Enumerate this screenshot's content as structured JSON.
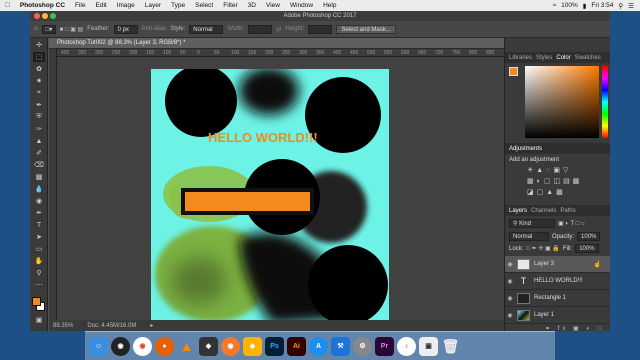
{
  "menubar": {
    "app_name": "Photoshop CC",
    "items": [
      "File",
      "Edit",
      "Image",
      "Layer",
      "Type",
      "Select",
      "Filter",
      "3D",
      "View",
      "Window",
      "Help"
    ],
    "battery": "100%",
    "clock": "Fri 3:54"
  },
  "window": {
    "title": "Adobe Photoshop CC 2017"
  },
  "options_bar": {
    "feather_label": "Feather:",
    "feather_value": "0 px",
    "antialias_label": "Anti-alias",
    "style_label": "Style:",
    "style_value": "Normal",
    "width_label": "Width:",
    "height_label": "Height:",
    "select_mask_label": "Select and Mask..."
  },
  "document": {
    "tab_title": "Photoshop Tut002 @ 88.3% (Layer 3, RGB/8*) *",
    "canvas_text": "HELLO WORLD!!!",
    "zoom": "88.35%",
    "doc_info": "Doc: 4.45M/16.0M"
  },
  "ruler_labels": [
    "400",
    "350",
    "300",
    "250",
    "200",
    "150",
    "100",
    "50",
    "0",
    "50",
    "100",
    "150",
    "200",
    "250",
    "300",
    "350",
    "400",
    "450",
    "500",
    "550",
    "600",
    "650",
    "700",
    "750",
    "800",
    "850"
  ],
  "panels": {
    "top_tabs": [
      "Libraries",
      "Styles",
      "Color",
      "Swatches"
    ],
    "active_top_tab": "Color",
    "adjustments_title": "Adjustments",
    "adjustments_hint": "Add an adjustment",
    "layer_tabs": [
      "Layers",
      "Channels",
      "Paths"
    ],
    "kind_label": "Kind",
    "blend_mode": "Normal",
    "opacity_label": "Opacity:",
    "opacity_value": "100%",
    "lock_label": "Lock:",
    "fill_label": "Fill:",
    "fill_value": "100%",
    "layers": [
      {
        "name": "Layer 3"
      },
      {
        "name": "HELLO WORLD!!!"
      },
      {
        "name": "Rectangle 1"
      },
      {
        "name": "Layer 1"
      }
    ]
  },
  "colors": {
    "canvas_bg": "#6df3e6",
    "accent_orange": "#f38a1c",
    "panel_bg": "#3a3a3a"
  },
  "dock": {
    "apps": [
      "finder",
      "siri",
      "chrome",
      "firefox",
      "vlc",
      "unity",
      "blender",
      "sketch",
      "photoshop",
      "illustrator",
      "appstore",
      "xcode",
      "settings",
      "premiere",
      "music",
      "preview",
      "trash"
    ]
  }
}
